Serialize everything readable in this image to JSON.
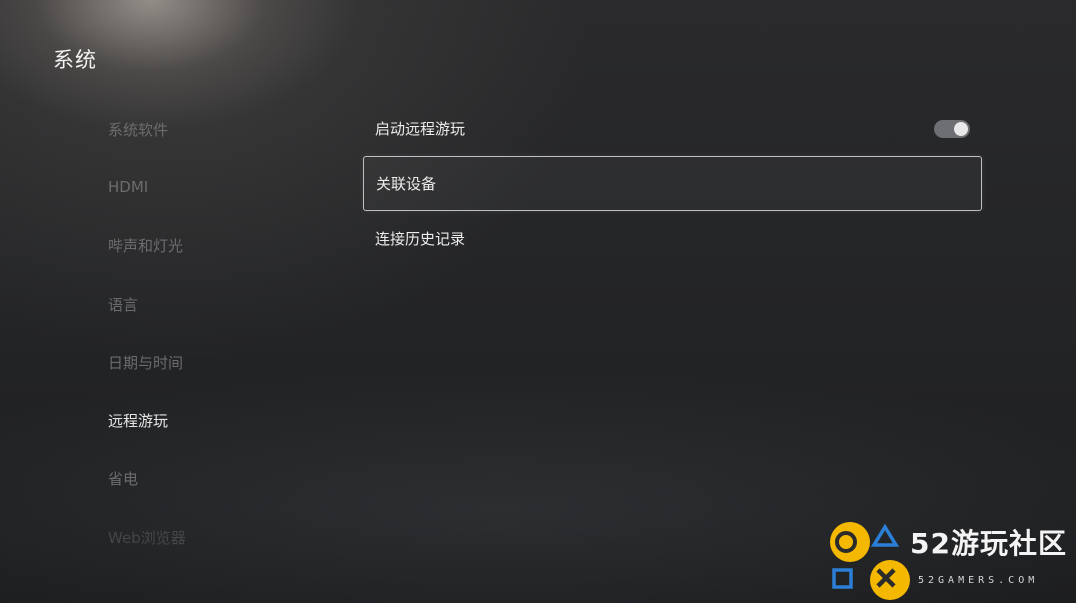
{
  "header": {
    "title": "系统"
  },
  "sidebar": {
    "items": [
      {
        "label": "系统软件"
      },
      {
        "label": "HDMI"
      },
      {
        "label": "哔声和灯光"
      },
      {
        "label": "语言"
      },
      {
        "label": "日期与时间"
      },
      {
        "label": "远程游玩"
      },
      {
        "label": "省电"
      },
      {
        "label": "Web浏览器"
      }
    ],
    "selected": "远程游玩"
  },
  "content": {
    "rows": [
      {
        "label": "启动远程游玩",
        "toggle": true
      },
      {
        "label": "关联设备"
      },
      {
        "label": "连接历史记录"
      }
    ],
    "focused": "关联设备"
  },
  "watermark": {
    "name": "52游玩社区",
    "site": "52GAMERS.COM",
    "colors": {
      "yellow": "#f5b800",
      "blue": "#2b7fd6"
    }
  }
}
